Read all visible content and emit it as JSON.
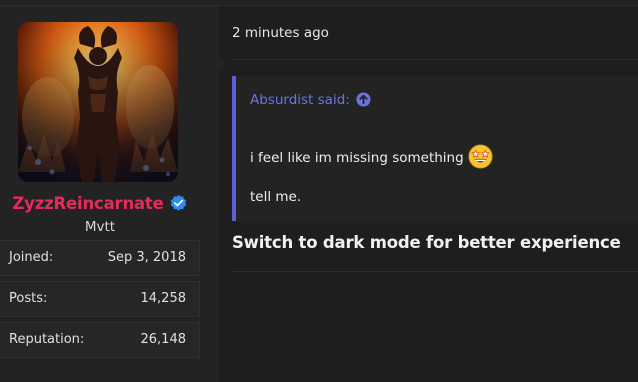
{
  "post": {
    "timestamp": "2 minutes ago",
    "quote": {
      "author_text": "Absurdist said:",
      "jump_icon": "arrow-up-circle-icon",
      "line1": "i feel like im missing something",
      "emoji": "star-struck-emoji-icon",
      "line2": "tell me."
    },
    "bold_text": "Switch to dark mode for better experience"
  },
  "user": {
    "username": "ZyzzReincarnate",
    "verified_icon": "verified-badge-icon",
    "title": "Mvtt",
    "username_color": "#e8295e",
    "stats": [
      {
        "label": "Joined:",
        "value": "Sep 3, 2018"
      },
      {
        "label": "Posts:",
        "value": "14,258"
      },
      {
        "label": "Reputation:",
        "value": "26,148"
      }
    ]
  },
  "colors": {
    "background": "#1e1e1e",
    "sidebar": "#232323",
    "quote_accent": "#5c5fd6",
    "quote_author": "#6d73e6",
    "verified_blue": "#2d8cf0"
  }
}
